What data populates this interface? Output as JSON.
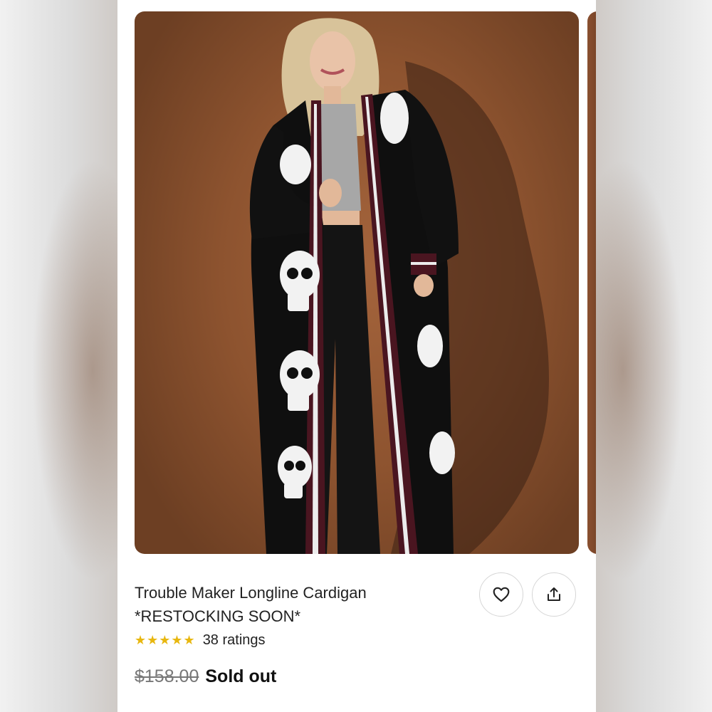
{
  "product": {
    "title_line1": "Trouble Maker Longline Cardigan",
    "title_line2": "*RESTOCKING SOON*",
    "rating_stars": "★★★★★",
    "rating_value": 5,
    "ratings_count": "38 ratings",
    "original_price": "$158.00",
    "availability": "Sold out"
  },
  "icons": {
    "favorite": "heart-icon",
    "share": "share-icon",
    "star": "star-icon"
  },
  "colors": {
    "star": "#e8b70f",
    "backdrop": "#8d532f"
  }
}
